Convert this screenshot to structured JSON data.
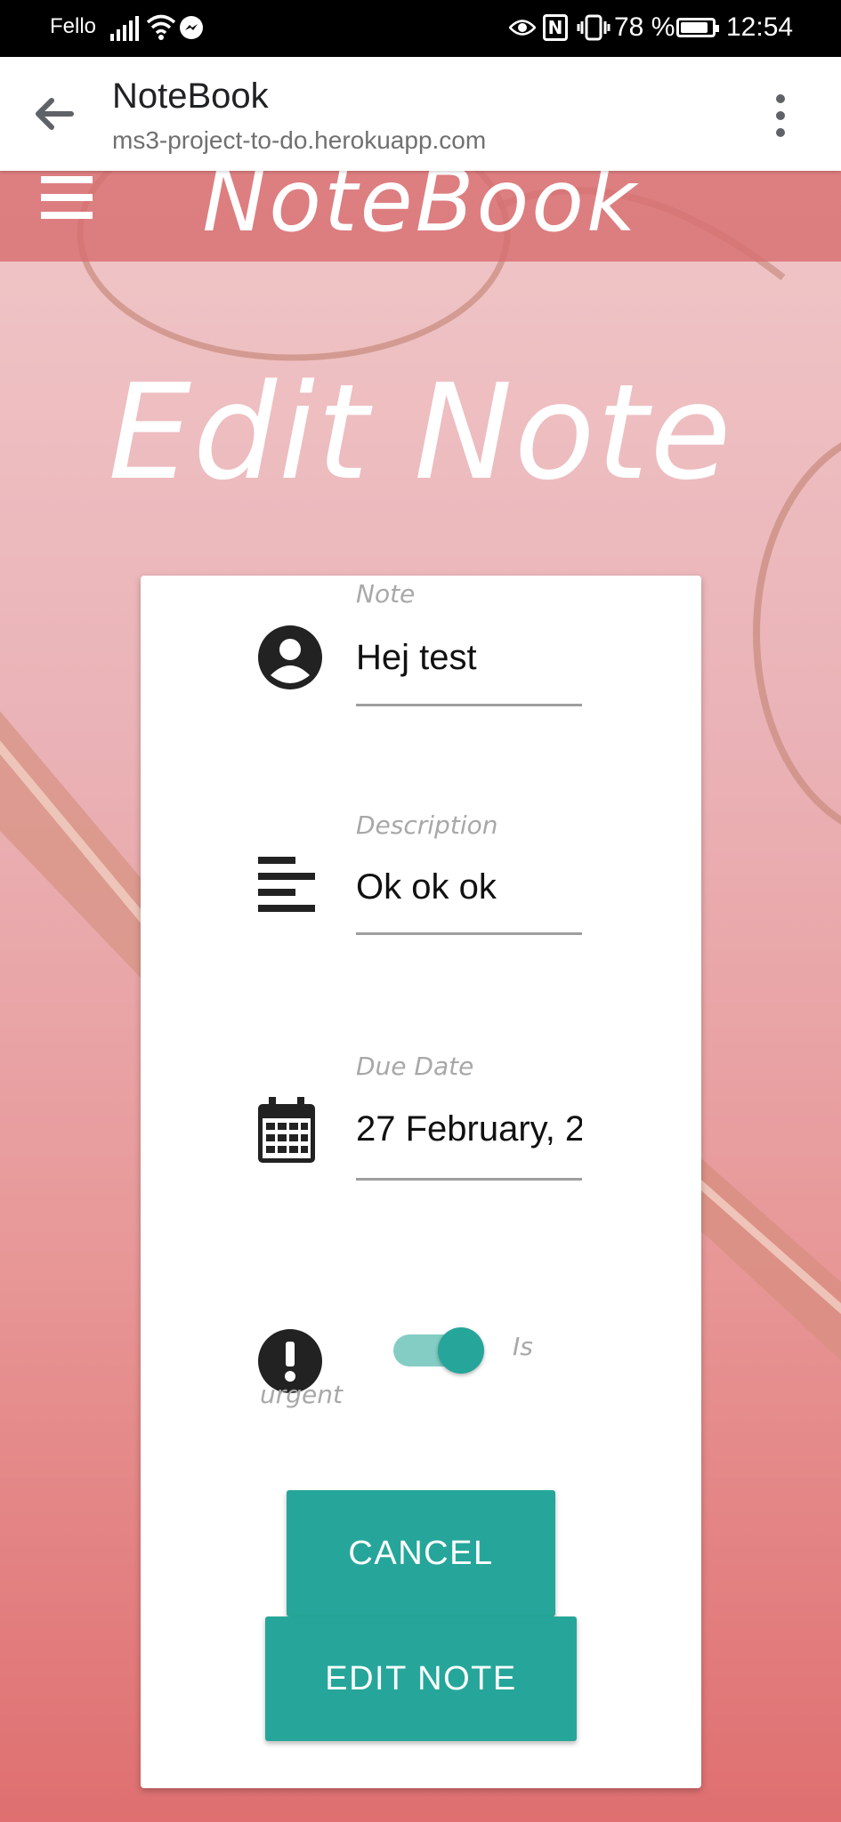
{
  "status_bar": {
    "carrier": "Fello",
    "battery_percent": "78 %",
    "time": "12:54",
    "icons": [
      "signal-icon",
      "wifi-icon",
      "messenger-icon",
      "eye-icon",
      "nfc-icon",
      "vibrate-icon",
      "battery-icon"
    ]
  },
  "browser": {
    "title": "NoteBook",
    "url": "ms3-project-to-do.herokuapp.com"
  },
  "site": {
    "brand": "NoteBook",
    "heading": "Edit Note"
  },
  "form": {
    "note": {
      "label": "Note",
      "value": "Hej test"
    },
    "description": {
      "label": "Description",
      "value": "Ok ok ok"
    },
    "due_date": {
      "label": "Due Date",
      "value": "27 February, 2"
    },
    "urgent": {
      "label": "Is urgent",
      "checked": true
    }
  },
  "buttons": {
    "cancel": "CANCEL",
    "edit": "EDIT NOTE"
  },
  "colors": {
    "accent": "#26a69a",
    "nav_bg": "#d86e70"
  }
}
